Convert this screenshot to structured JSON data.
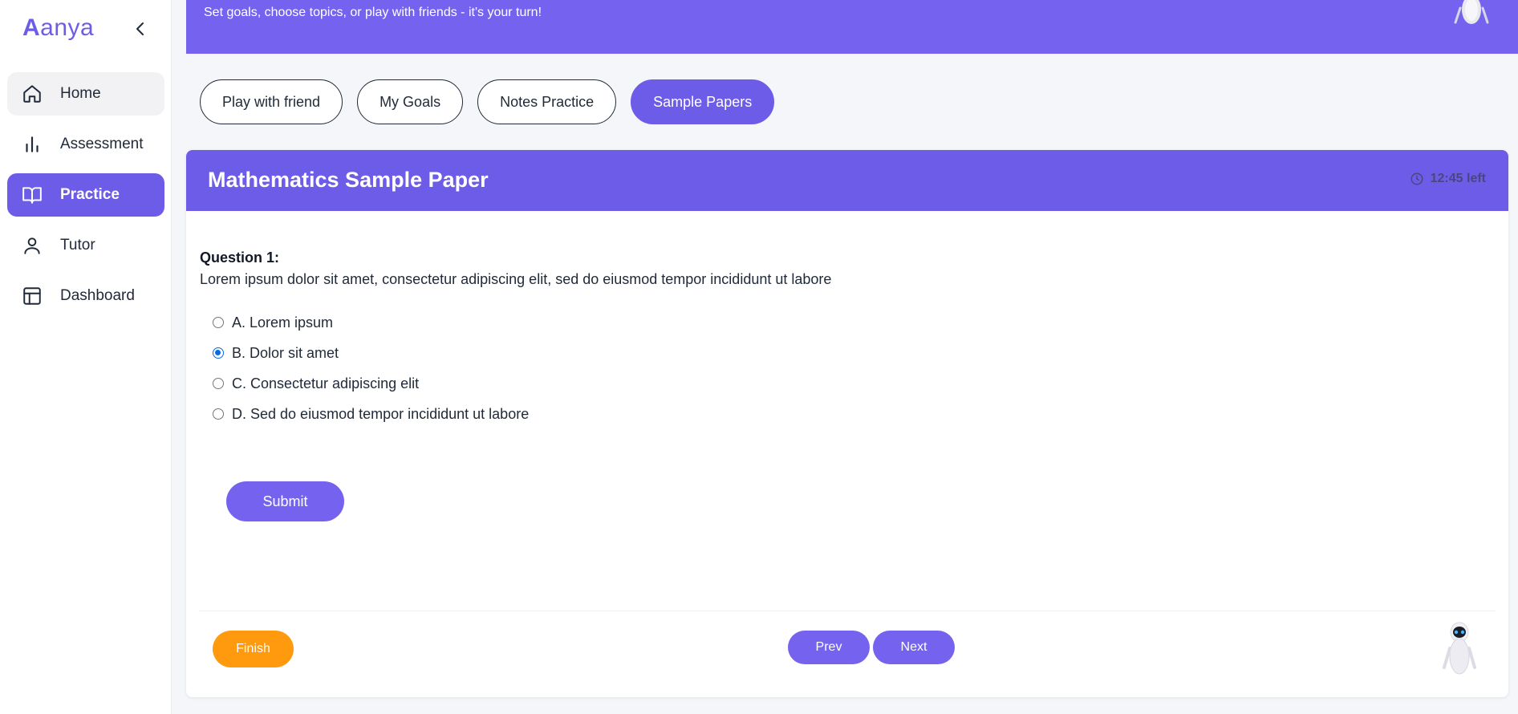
{
  "brand": {
    "first": "A",
    "rest": "anya"
  },
  "sidebar": {
    "items": [
      {
        "label": "Home",
        "icon": "home-icon"
      },
      {
        "label": "Assessment",
        "icon": "bar-chart-icon"
      },
      {
        "label": "Practice",
        "icon": "book-open-icon"
      },
      {
        "label": "Tutor",
        "icon": "user-icon"
      },
      {
        "label": "Dashboard",
        "icon": "layout-icon"
      }
    ],
    "active": "Practice"
  },
  "banner": {
    "text": "Set goals, choose topics, or play with friends - it's your turn!"
  },
  "tabs": [
    {
      "label": "Play with friend"
    },
    {
      "label": "My Goals"
    },
    {
      "label": "Notes Practice"
    },
    {
      "label": "Sample Papers"
    }
  ],
  "active_tab": "Sample Papers",
  "paper": {
    "title": "Mathematics Sample Paper",
    "timer": "12:45 left"
  },
  "question": {
    "label": "Question 1:",
    "text": "Lorem ipsum dolor sit amet, consectetur adipiscing elit, sed do eiusmod tempor incididunt ut labore",
    "options": [
      {
        "label": "A. Lorem ipsum",
        "selected": false
      },
      {
        "label": "B. Dolor sit amet",
        "selected": true
      },
      {
        "label": "C. Consectetur adipiscing elit",
        "selected": false
      },
      {
        "label": "D. Sed do eiusmod tempor incididunt ut labore",
        "selected": false
      }
    ]
  },
  "actions": {
    "submit": "Submit",
    "finish": "Finish",
    "prev": "Prev",
    "next": "Next"
  },
  "colors": {
    "accent": "#6d5ce8",
    "banner": "#7563f0",
    "finish": "#ff9a0f",
    "radio_checked": "#0b6bde"
  }
}
